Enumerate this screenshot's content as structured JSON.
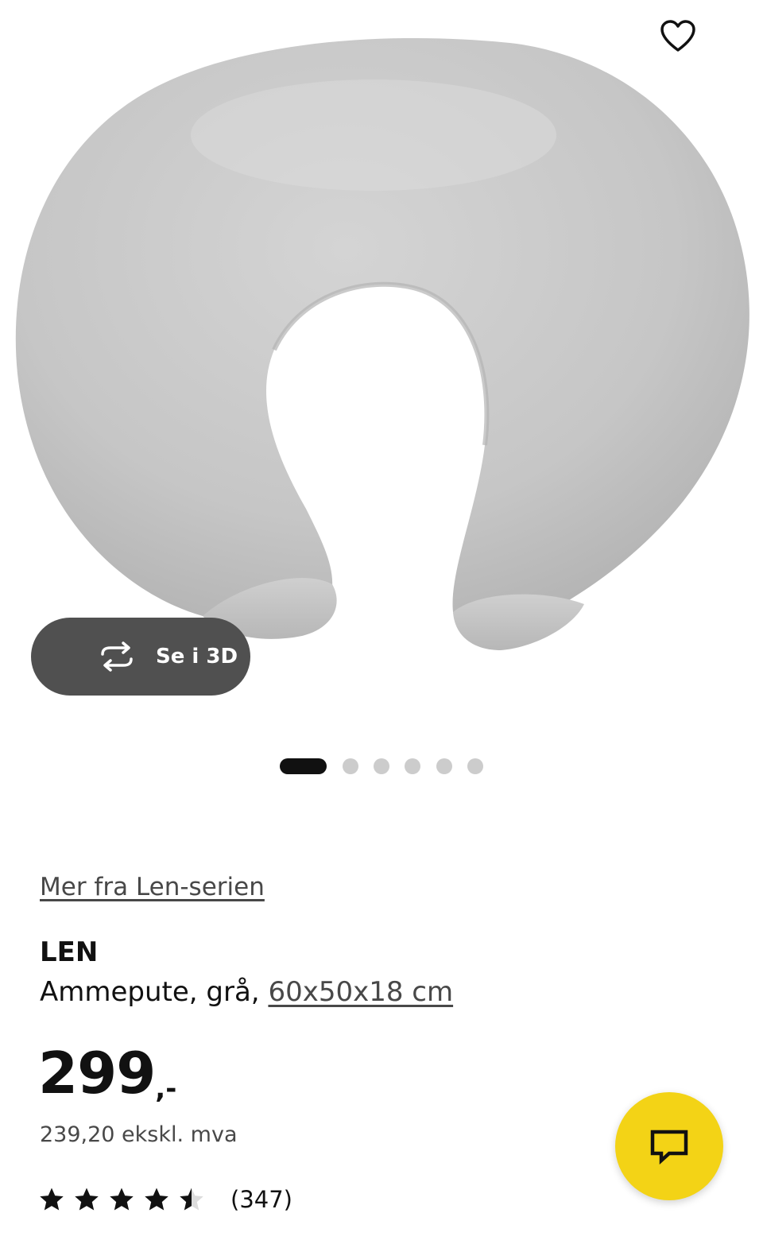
{
  "product_image": {
    "alt": "Ammepute, grå",
    "color": "#c9c9c9"
  },
  "favorite": {
    "icon": "heart-outline-icon"
  },
  "view_3d": {
    "icon": "rotate-arrows-icon",
    "label": "Se i 3D"
  },
  "carousel": {
    "total": 6,
    "active_index": 0
  },
  "series_link": "Mer fra Len-serien",
  "product": {
    "name": "LEN",
    "description_prefix": "Ammepute, grå, ",
    "size": "60x50x18 cm"
  },
  "price": {
    "amount": "299",
    "suffix": ",-",
    "excl_vat": "239,20 ekskl. mva"
  },
  "rating": {
    "stars": 4.5,
    "max": 5,
    "count": "(347)"
  },
  "chat": {
    "icon": "chat-bubble-icon",
    "color": "#f3d316"
  }
}
